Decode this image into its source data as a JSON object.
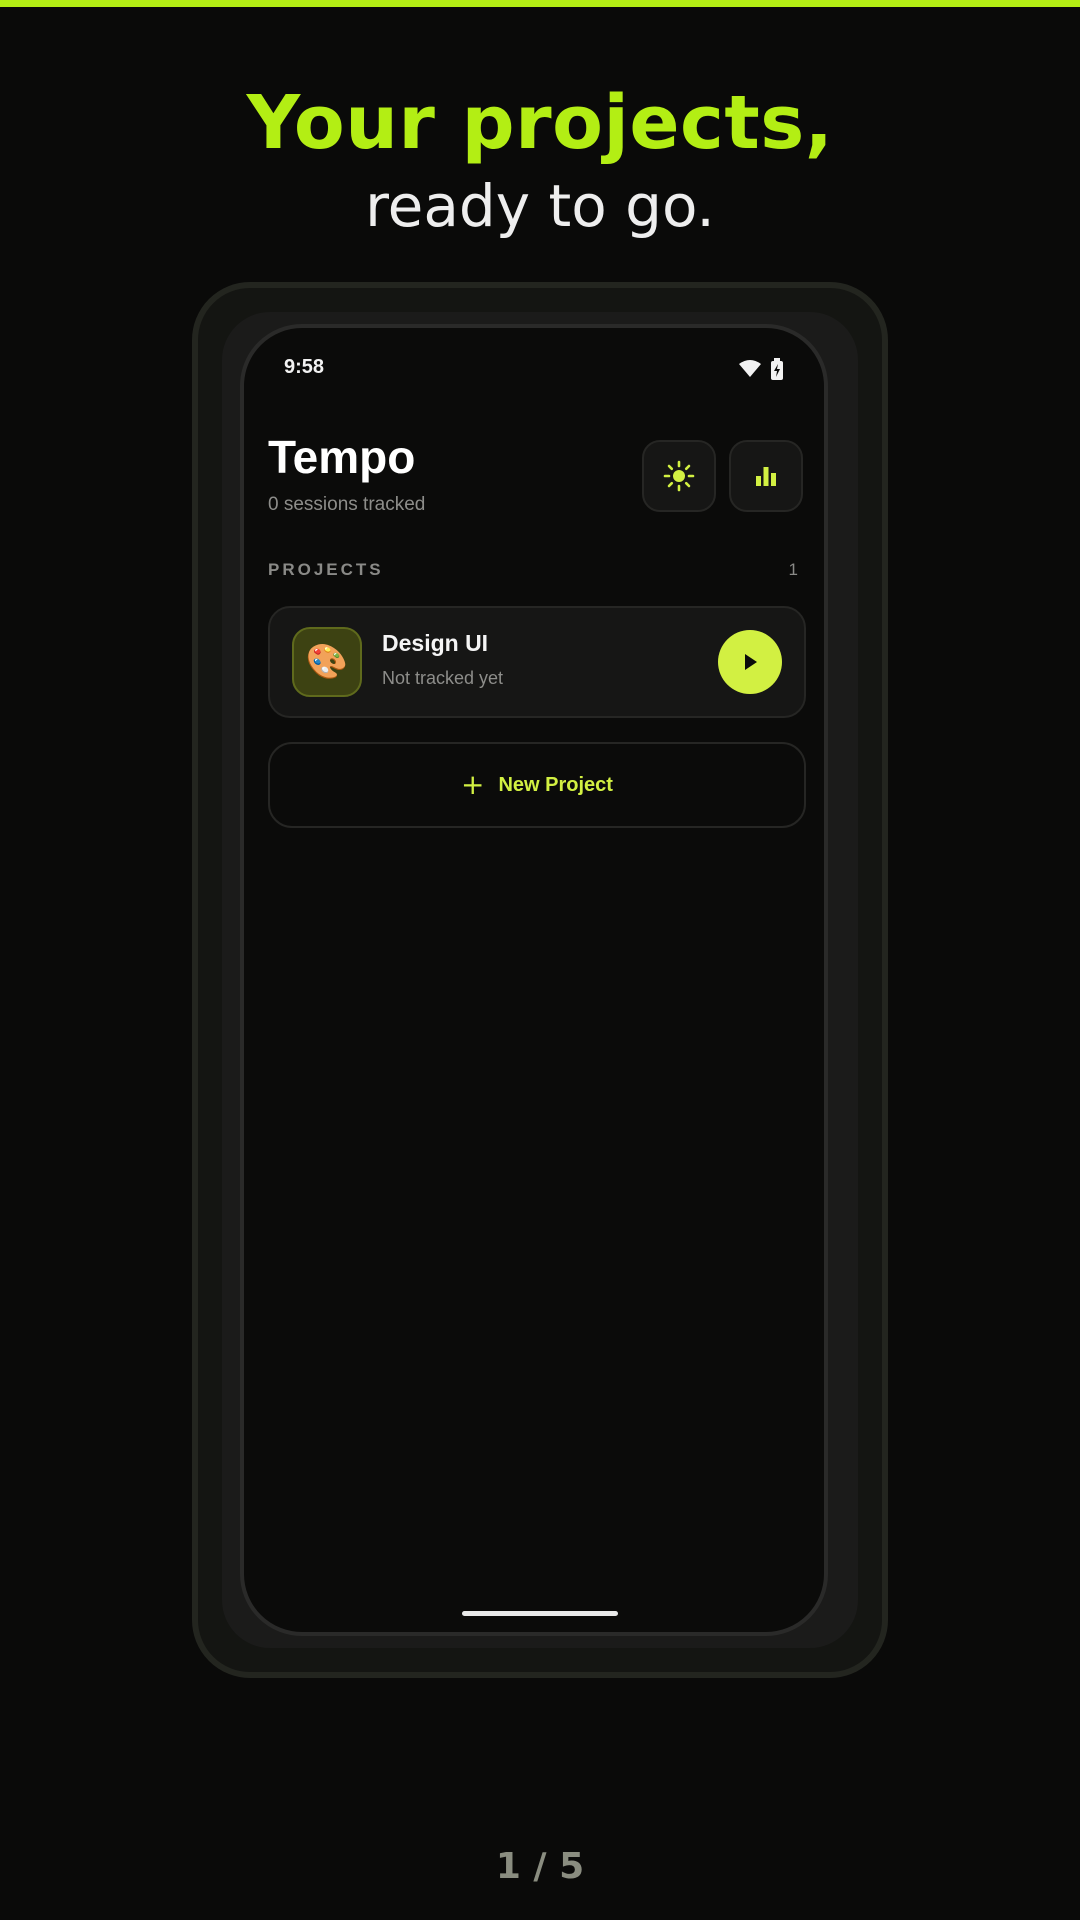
{
  "hero": {
    "title": "Your projects,",
    "subtitle": "ready to go."
  },
  "status_bar": {
    "time": "9:58",
    "icons": [
      "wifi-icon",
      "battery-icon"
    ]
  },
  "header": {
    "title": "Tempo",
    "subtitle": "0 sessions tracked",
    "buttons": [
      {
        "icon": "sun-icon",
        "role": "theme-toggle"
      },
      {
        "icon": "bar-chart-icon",
        "role": "stats"
      }
    ]
  },
  "projects": {
    "label": "PROJECTS",
    "count": "1",
    "items": [
      {
        "emoji": "🎨",
        "name": "Design UI",
        "meta": "Not tracked yet",
        "action_icon": "play-icon"
      }
    ]
  },
  "new_project": {
    "plus": "+",
    "label": "New Project"
  },
  "pager": "1 / 5",
  "colors": {
    "accent": "#b3ee14",
    "button_accent": "#d2f042",
    "background": "#0a0a09"
  }
}
